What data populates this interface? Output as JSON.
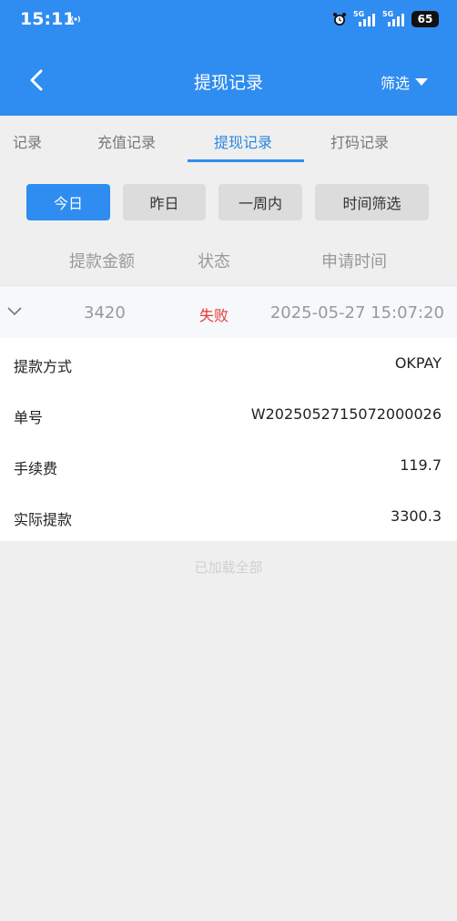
{
  "status_bar": {
    "time": "15:11",
    "network_label_1": "5G",
    "network_label_2": "5G",
    "battery": "65"
  },
  "nav": {
    "title": "提现记录",
    "filter_label": "筛选"
  },
  "tabs": [
    {
      "label": "记录"
    },
    {
      "label": "充值记录"
    },
    {
      "label": "提现记录",
      "active": true
    },
    {
      "label": "打码记录"
    }
  ],
  "date_filters": [
    {
      "label": "今日",
      "active": true
    },
    {
      "label": "昨日"
    },
    {
      "label": "一周内"
    },
    {
      "label": "时间筛选"
    }
  ],
  "columns": {
    "amount": "提款金额",
    "status": "状态",
    "time": "申请时间"
  },
  "record": {
    "amount": "3420",
    "status": "失败",
    "time": "2025-05-27 15:07:20"
  },
  "details": [
    {
      "label": "提款方式",
      "value": "OKPAY"
    },
    {
      "label": "单号",
      "value": "W2025052715072000026"
    },
    {
      "label": "手续费",
      "value": "119.7"
    },
    {
      "label": "实际提款",
      "value": "3300.3"
    }
  ],
  "footer": {
    "loaded_all": "已加载全部"
  },
  "colors": {
    "primary": "#2f8cf0",
    "failure": "#e53935"
  }
}
